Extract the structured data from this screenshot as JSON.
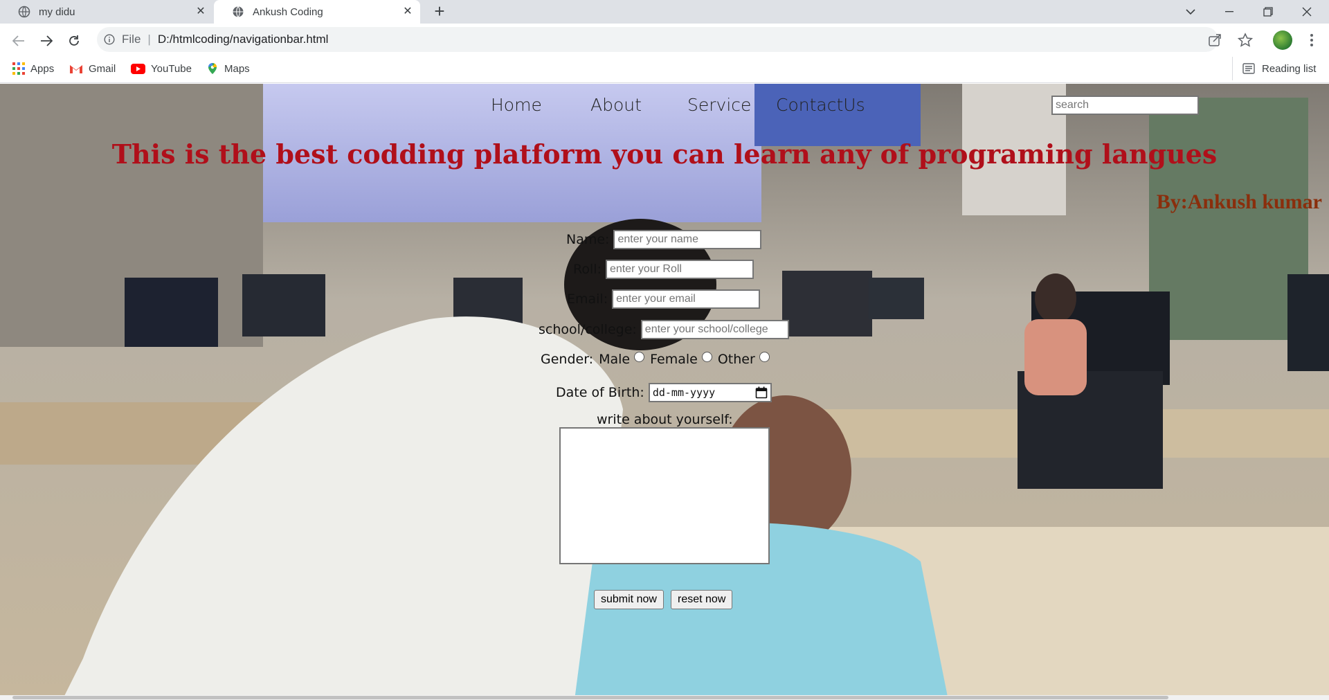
{
  "browser": {
    "tabs": [
      {
        "title": "my didu",
        "active": false
      },
      {
        "title": "Ankush Coding",
        "active": true
      }
    ],
    "address": {
      "scheme": "File",
      "path": "D:/htmlcoding/navigationbar.html"
    },
    "bookmarks": [
      {
        "label": "Apps",
        "icon": "apps-grid-icon"
      },
      {
        "label": "Gmail",
        "icon": "gmail-icon"
      },
      {
        "label": "YouTube",
        "icon": "youtube-icon"
      },
      {
        "label": "Maps",
        "icon": "maps-icon"
      }
    ],
    "reading_list": "Reading list"
  },
  "page": {
    "nav": [
      "Home",
      "About",
      "Service",
      "ContactUs"
    ],
    "search_placeholder": "search",
    "headline": "This is the best codding platform you can learn any of programing langues",
    "byline": "By:Ankush kumar",
    "form": {
      "name_label": "Name:",
      "name_placeholder": "enter your name",
      "roll_label": "Roll:",
      "roll_placeholder": "enter your Roll",
      "email_label": "Email:",
      "email_placeholder": "enter your email",
      "school_label": "school/college:",
      "school_placeholder": "enter your school/college",
      "gender_label": "Gender:",
      "gender_options": [
        "Male",
        "Female",
        "Other"
      ],
      "dob_label": "Date of Birth:",
      "dob_placeholder": "dd-mm-yyyy",
      "about_label": "write about yourself:",
      "submit": "submit now",
      "reset": "reset now"
    }
  },
  "colors": {
    "headline": "#b00f1a",
    "byline": "#8a2e0c",
    "tabstrip": "#dee1e6"
  }
}
